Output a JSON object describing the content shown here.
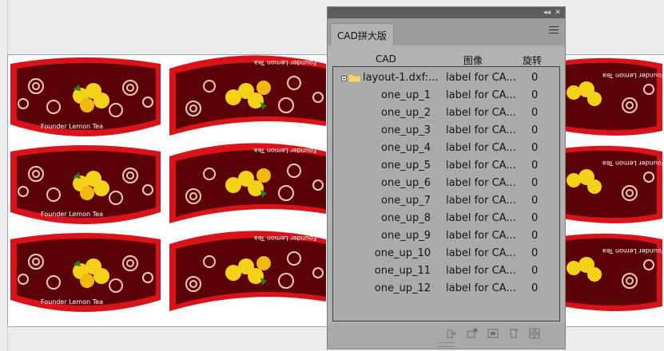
{
  "artwork": {
    "brand_text": "Founder Lemon Tea",
    "colors": {
      "red": "#d8141a",
      "dark": "#5a0208",
      "swirl": "#f0c9b2",
      "lemon": "#f5d21a"
    }
  },
  "panel": {
    "title": "CAD拼大版",
    "controls": {
      "collapse": "◂◂",
      "close": "✕"
    },
    "columns": {
      "cad": "CAD",
      "image": "图像",
      "rotate": "旋转"
    },
    "root": {
      "name": "layout-1.dxf:...",
      "label": "label for CA...",
      "rotation": "0"
    },
    "items": [
      {
        "name": "one_up_1",
        "label": "label for CA...",
        "rotation": "0"
      },
      {
        "name": "one_up_2",
        "label": "label for CA...",
        "rotation": "0"
      },
      {
        "name": "one_up_3",
        "label": "label for CA...",
        "rotation": "0"
      },
      {
        "name": "one_up_4",
        "label": "label for CA...",
        "rotation": "0"
      },
      {
        "name": "one_up_5",
        "label": "label for CA...",
        "rotation": "0"
      },
      {
        "name": "one_up_6",
        "label": "label for CA...",
        "rotation": "0"
      },
      {
        "name": "one_up_7",
        "label": "label for CA...",
        "rotation": "0"
      },
      {
        "name": "one_up_8",
        "label": "label for CA...",
        "rotation": "0"
      },
      {
        "name": "one_up_9",
        "label": "label for CA...",
        "rotation": "0"
      },
      {
        "name": "one_up_10",
        "label": "label for CA...",
        "rotation": "0"
      },
      {
        "name": "one_up_11",
        "label": "label for CA...",
        "rotation": "0"
      },
      {
        "name": "one_up_12",
        "label": "label for CA...",
        "rotation": "0"
      }
    ],
    "bottom_icons": [
      "import-cad-icon",
      "replace-image-icon",
      "fit-frame-icon",
      "place-label-icon",
      "layout-grid-icon"
    ]
  }
}
